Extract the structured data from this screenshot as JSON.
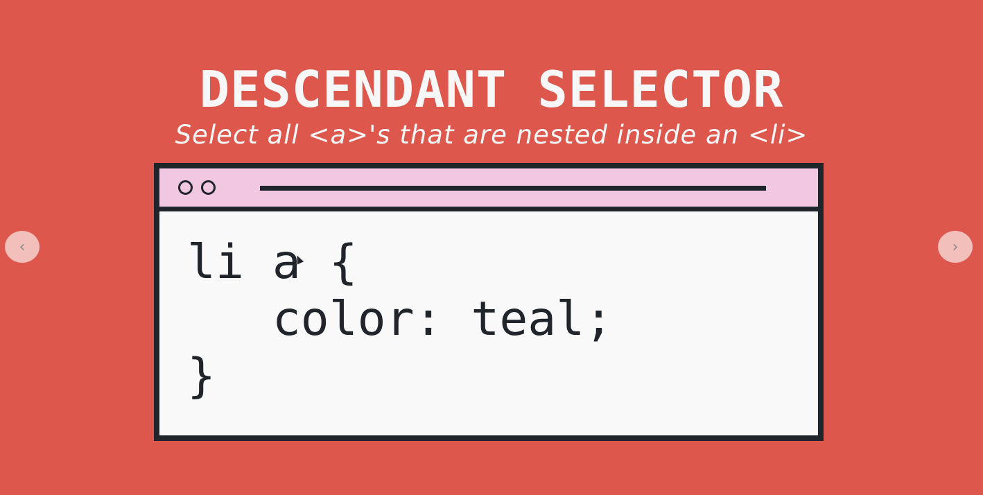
{
  "slide": {
    "title": "DESCENDANT SELECTOR",
    "subtitle": "Select all <a>'s that are nested inside an <li>"
  },
  "code_window": {
    "lines": [
      "li a {",
      "   color: teal;",
      "}"
    ]
  },
  "navigation": {
    "prev_icon": "chevron-left-icon",
    "prev_glyph": "‹",
    "next_icon": "chevron-right-icon",
    "next_glyph": "›"
  },
  "colors": {
    "background": "#de574c",
    "titlebar": "#f1c7e1",
    "frame": "#20242b",
    "code_bg": "#f9f9f9",
    "text_light": "#f7f7f7"
  }
}
